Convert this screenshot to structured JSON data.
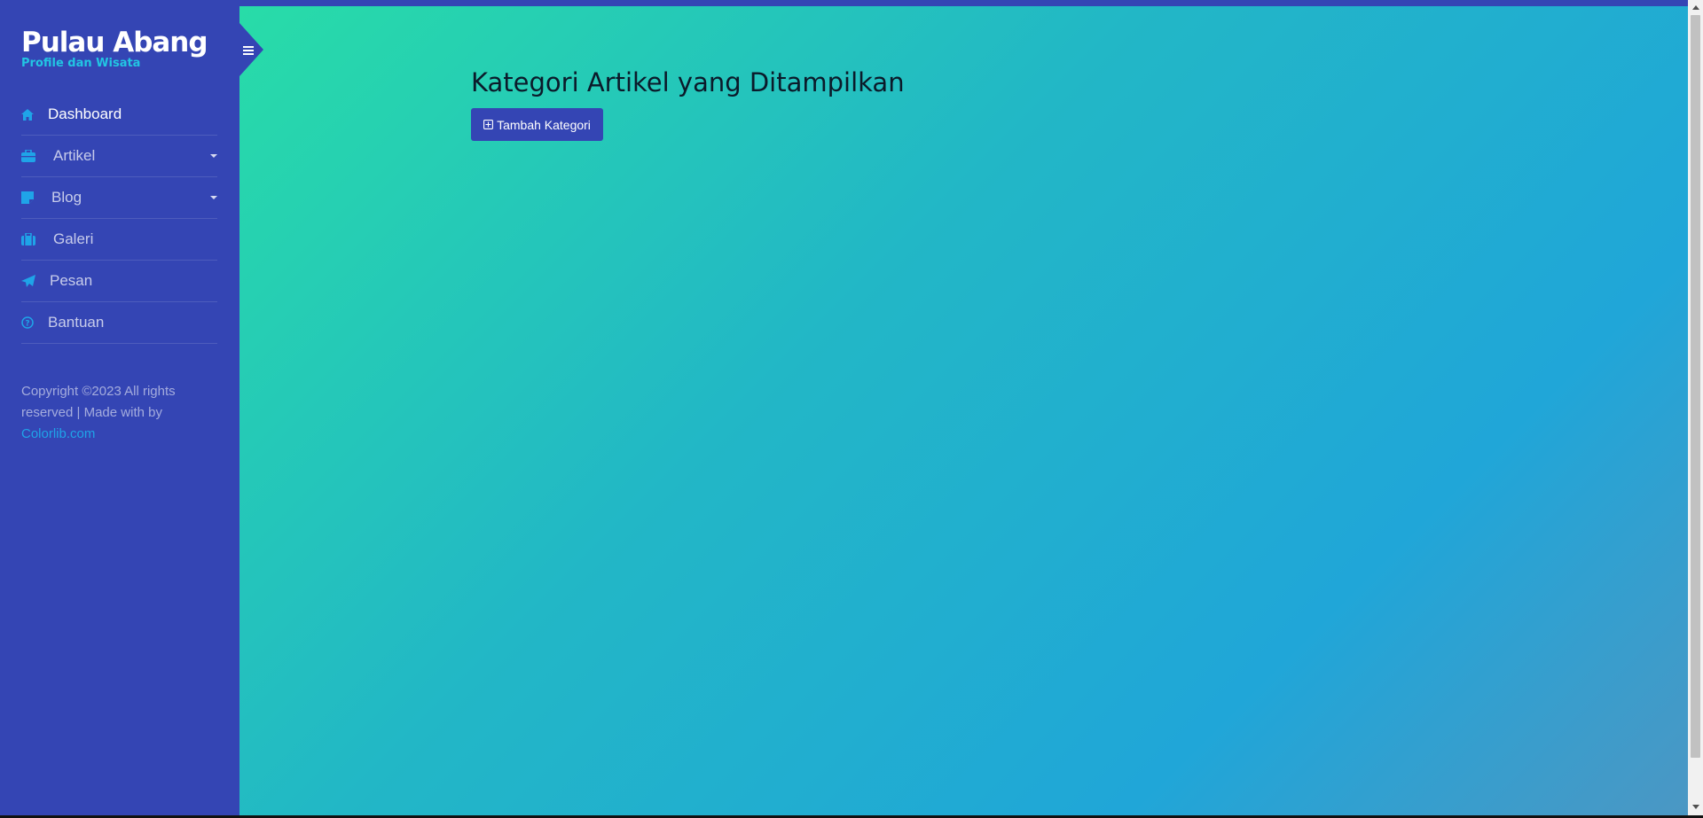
{
  "brand": {
    "title": "Pulau Abang",
    "subtitle": "Profile dan Wisata"
  },
  "sidebar": {
    "items": [
      {
        "label": "Dashboard",
        "icon": "home-icon"
      },
      {
        "label": "Artikel",
        "icon": "briefcase-icon",
        "has_dropdown": true
      },
      {
        "label": "Blog",
        "icon": "sticky-note-icon",
        "has_dropdown": true
      },
      {
        "label": "Galeri",
        "icon": "suitcase-icon"
      },
      {
        "label": "Pesan",
        "icon": "paper-plane-icon"
      },
      {
        "label": "Bantuan",
        "icon": "question-circle-icon"
      }
    ],
    "footer_text": "Copyright ©2023 All rights reserved | Made with by",
    "footer_link": "Colorlib.com"
  },
  "main": {
    "title": "Kategori Artikel yang Ditampilkan",
    "add_button": "Tambah Kategori"
  },
  "colors": {
    "sidebar": "#3445b4",
    "accent": "#1fa4e8",
    "gradient_start": "#28dca8",
    "gradient_end": "#20a6d8"
  }
}
